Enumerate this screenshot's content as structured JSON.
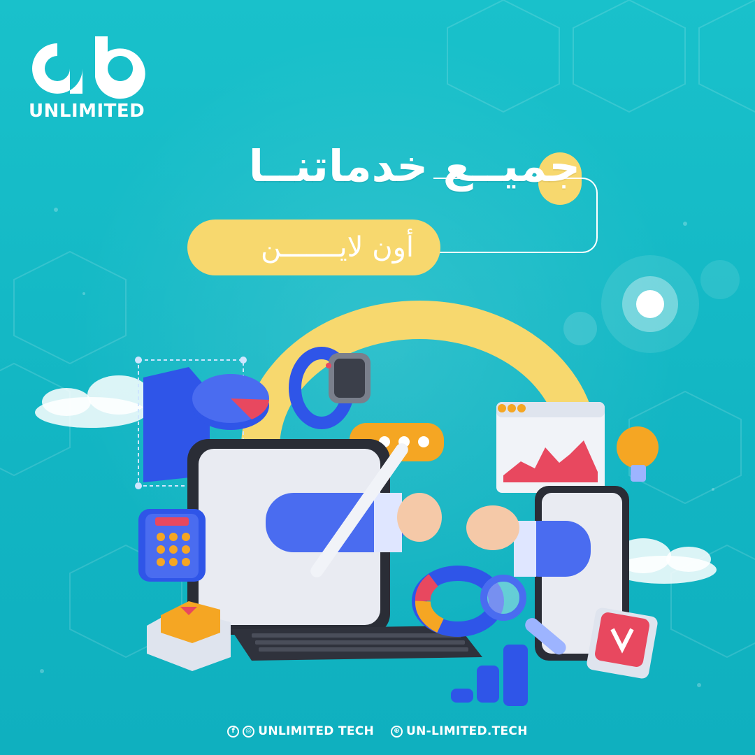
{
  "brand": {
    "logo_glyph": "ab",
    "name": "UNLIMITED"
  },
  "headline": {
    "title": "جميــع خدماتنــا",
    "subtitle": "أون لايـــــــن"
  },
  "footer": {
    "social_handle": "UNLIMITED TECH",
    "website": "UN-LIMITED.TECH"
  },
  "colors": {
    "background": "#13b8c4",
    "accent_yellow": "#f7d86e",
    "text": "#ffffff",
    "device_blue": "#4a6cf0"
  },
  "icons": [
    "facebook-icon",
    "instagram-icon",
    "globe-icon"
  ]
}
